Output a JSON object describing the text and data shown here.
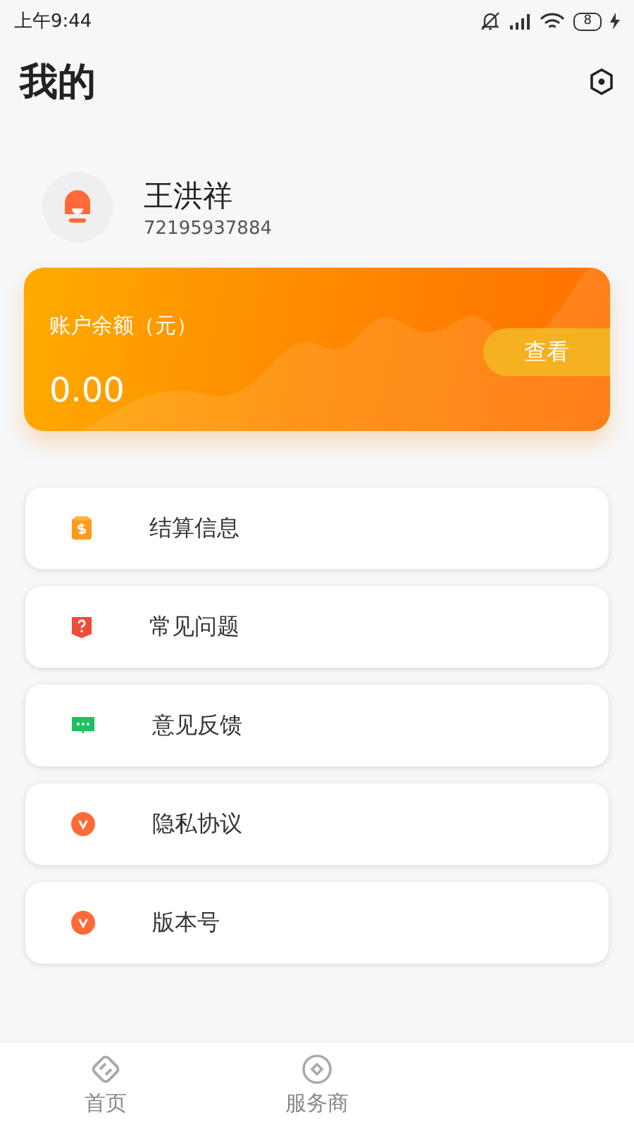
{
  "status_bar": {
    "time": "上午9:44",
    "battery": "8"
  },
  "header": {
    "title": "我的"
  },
  "profile": {
    "name": "王洪祥",
    "account": "72195937884"
  },
  "balance_card": {
    "label": "账户余额（元）",
    "amount": "0.00",
    "button": "查看"
  },
  "menu": [
    {
      "label": "结算信息",
      "kind": "wallet"
    },
    {
      "label": "常见问题",
      "kind": "question"
    },
    {
      "label": "意见反馈",
      "kind": "chat"
    },
    {
      "label": "隐私协议",
      "kind": "badge"
    },
    {
      "label": "版本号",
      "kind": "badge"
    }
  ],
  "tab_bar": [
    {
      "label": "首页",
      "kind": "home",
      "selected": false
    },
    {
      "label": "服务商",
      "kind": "service",
      "selected": false
    }
  ]
}
